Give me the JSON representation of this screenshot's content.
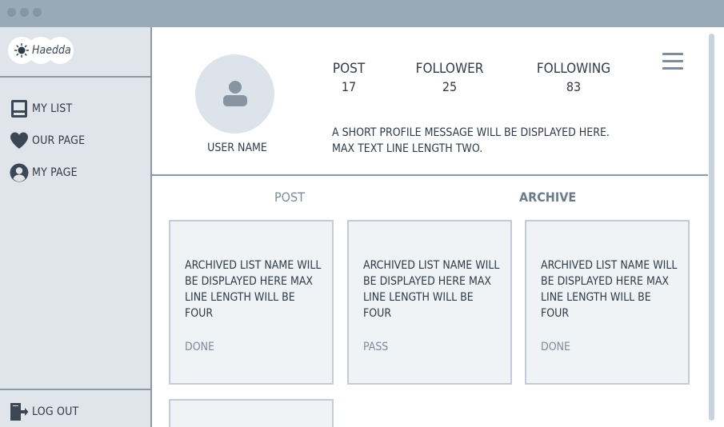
{
  "app": {
    "logo_text": "Haedda"
  },
  "sidebar": {
    "items": [
      {
        "label": "MY LIST"
      },
      {
        "label": "OUR PAGE"
      },
      {
        "label": "MY PAGE"
      }
    ],
    "logout_label": "LOG OUT"
  },
  "profile": {
    "username": "USER NAME",
    "stats": [
      {
        "label": "POST",
        "value": "17"
      },
      {
        "label": "FOLLOWER",
        "value": "25"
      },
      {
        "label": "FOLLOWING",
        "value": "83"
      }
    ],
    "bio_line1": "A SHORT PROFILE MESSAGE WILL BE DISPLAYED HERE.",
    "bio_line2": "MAX TEXT LINE LENGTH TWO."
  },
  "tabs": {
    "post": "POST",
    "archive": "ARCHIVE",
    "active": "archive"
  },
  "cards": [
    {
      "title": "ARCHIVED LIST NAME WILL BE DISPLAYED HERE MAX LINE LENGTH WILL BE FOUR",
      "status": "DONE"
    },
    {
      "title": "ARCHIVED LIST NAME WILL BE DISPLAYED HERE MAX LINE LENGTH WILL BE FOUR",
      "status": "PASS"
    },
    {
      "title": "ARCHIVED LIST NAME WILL BE DISPLAYED HERE MAX LINE LENGTH WILL BE FOUR",
      "status": "DONE"
    },
    {
      "title": "",
      "status": ""
    }
  ],
  "colors": {
    "titlebar": "#9aa9b7",
    "sidebar": "#e0e5ec",
    "icon": "#3b4754",
    "muted": "#7c8a98"
  }
}
